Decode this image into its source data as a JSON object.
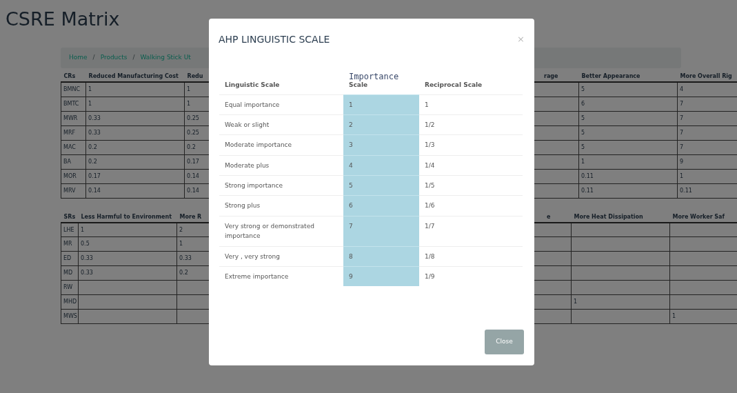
{
  "page": {
    "title": "CSRE Matrix"
  },
  "breadcrumb": {
    "items": [
      {
        "label": "Home"
      },
      {
        "label": "Products"
      },
      {
        "label": "Walking Stick Ut"
      }
    ],
    "separators": [
      "/",
      "/"
    ]
  },
  "criteria_table": {
    "corner": "CRs",
    "columns": [
      {
        "header": "Reduced Manufacturing Cost"
      },
      {
        "header": "Redu"
      },
      {},
      {},
      {
        "header": "rage",
        "text_cut_at_left": true
      },
      {
        "header": "Better Appearance"
      },
      {
        "header": "More Overall Rig"
      }
    ],
    "rows": [
      {
        "label": "BMNC",
        "cells": [
          "1",
          "1",
          null,
          null,
          null,
          "5",
          "4"
        ]
      },
      {
        "label": "BMTC",
        "cells": [
          "1",
          "1",
          null,
          null,
          null,
          "6",
          "7"
        ]
      },
      {
        "label": "MWR",
        "cells": [
          "0.33",
          "0.25",
          null,
          null,
          null,
          "5",
          "7"
        ]
      },
      {
        "label": "MRF",
        "cells": [
          "0.33",
          "0.25",
          null,
          null,
          null,
          "5",
          "7"
        ]
      },
      {
        "label": "MAC",
        "cells": [
          "0.2",
          "0.2",
          null,
          null,
          null,
          "5",
          "7"
        ]
      },
      {
        "label": "BA",
        "cells": [
          "0.2",
          "0.17",
          null,
          null,
          null,
          "1",
          "9"
        ]
      },
      {
        "label": "MOR",
        "cells": [
          "0.17",
          "0.14",
          null,
          null,
          null,
          "0.11",
          "1"
        ]
      },
      {
        "label": "MRV",
        "cells": [
          "0.14",
          "0.14",
          null,
          null,
          null,
          "0.11",
          "0.11"
        ]
      }
    ]
  },
  "sub_table": {
    "corner": "SRs",
    "columns": [
      {
        "header": "Less Harmful to Environment"
      },
      {
        "header": "More R"
      },
      {},
      {},
      {
        "header": "e",
        "text_cut_at_left": true
      },
      {
        "header": "More Heat Dissipation"
      },
      {
        "header": "More Worker Saf"
      }
    ],
    "rows": [
      {
        "label": "LHE",
        "cells": [
          "1",
          "2",
          null,
          null,
          null,
          null,
          null
        ]
      },
      {
        "label": "MR",
        "cells": [
          "0.5",
          "1",
          null,
          null,
          null,
          null,
          null
        ]
      },
      {
        "label": "ED",
        "cells": [
          "0.33",
          "0.33",
          null,
          null,
          null,
          null,
          null
        ]
      },
      {
        "label": "MD",
        "cells": [
          "0.33",
          "0.2",
          null,
          null,
          null,
          null,
          null
        ]
      },
      {
        "label": "RW",
        "cells": [
          null,
          null,
          null,
          null,
          null,
          null,
          null
        ]
      },
      {
        "label": "MHD",
        "cells": [
          null,
          null,
          null,
          null,
          null,
          "1",
          null
        ]
      },
      {
        "label": "MWS",
        "cells": [
          null,
          null,
          null,
          null,
          null,
          null,
          "1"
        ]
      }
    ]
  },
  "modal": {
    "title": "AHP LINGUISTIC SCALE",
    "close": "×",
    "columns": [
      {
        "label": "Linguistic Scale"
      },
      {
        "label": "Importance",
        "sub": "Scale",
        "color": "#acd6e2"
      },
      {
        "label": "Reciprocal Scale"
      }
    ],
    "rows": [
      [
        "Equal importance",
        "1",
        "1"
      ],
      [
        "Weak or slight",
        "2",
        "1/2"
      ],
      [
        "Moderate importance",
        "3",
        "1/3"
      ],
      [
        "Moderate plus",
        "4",
        "1/4"
      ],
      [
        "Strong importance",
        "5",
        "1/5"
      ],
      [
        "Strong plus",
        "6",
        "1/6"
      ],
      [
        "Very strong or demonstrated importance",
        "7",
        "1/7"
      ],
      [
        "Very , very strong",
        "8",
        "1/8"
      ],
      [
        "Extreme importance",
        "9",
        "1/9"
      ]
    ],
    "button": "Close"
  }
}
